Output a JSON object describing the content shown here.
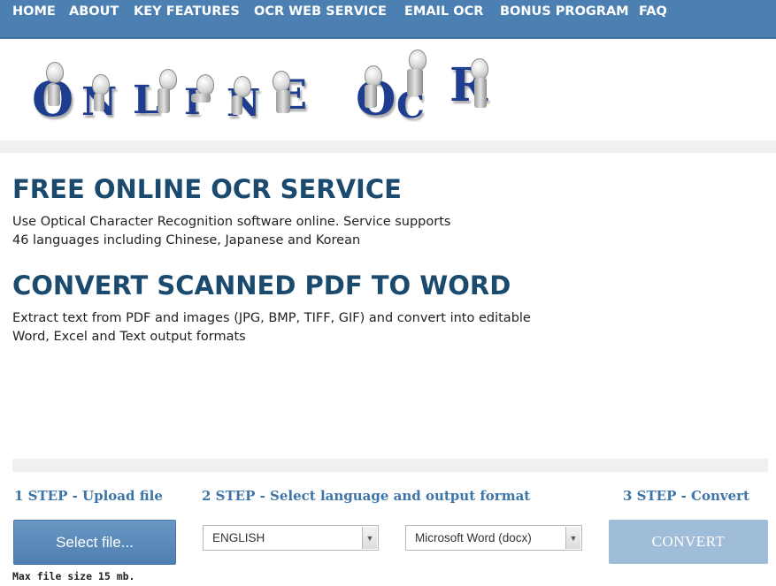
{
  "nav": {
    "items": [
      "HOME",
      "ABOUT",
      "KEY FEATURES",
      "OCR WEB SERVICE",
      "EMAIL OCR",
      "BONUS PROGRAM",
      "FAQ"
    ]
  },
  "logo": {
    "letters": [
      "O",
      "N",
      "L",
      "I",
      "N",
      "E",
      "O",
      "C",
      "R"
    ]
  },
  "sections": [
    {
      "heading": "FREE ONLINE OCR SERVICE",
      "lines": [
        "Use Optical Character Recognition software online. Service supports",
        "46 languages including Chinese, Japanese and Korean"
      ]
    },
    {
      "heading": "CONVERT SCANNED PDF TO WORD",
      "lines": [
        "Extract text from PDF and images (JPG, BMP, TIFF, GIF) and convert into editable",
        "Word, Excel and Text output formats"
      ]
    }
  ],
  "steps": {
    "step1": "1 STEP - Upload file",
    "step2": "2 STEP - Select language and output format",
    "step3": "3 STEP - Convert"
  },
  "upload": {
    "button_label": "Select file...",
    "max_size": "Max file size 15 mb."
  },
  "language_select": {
    "value": "ENGLISH"
  },
  "format_select": {
    "value": "Microsoft Word (docx)"
  },
  "convert": {
    "label": "CONVERT"
  },
  "colors": {
    "nav": "#4c80b3",
    "heading": "#1a4a6e",
    "step": "#3e75a8",
    "logo_letters": "#1e3d8f"
  }
}
